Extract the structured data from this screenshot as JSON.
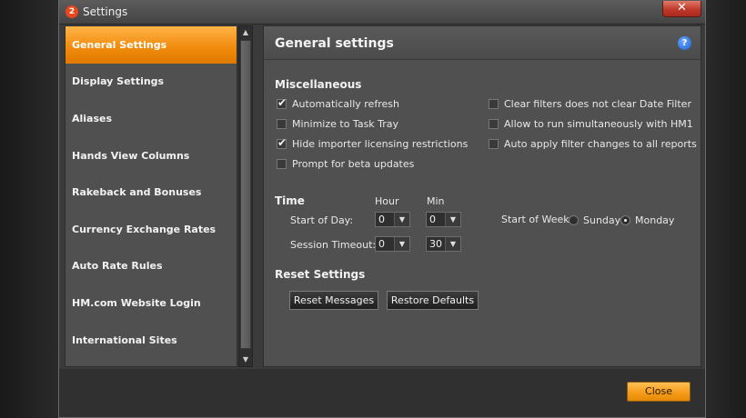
{
  "window": {
    "logo_text": "2",
    "title": "Settings",
    "close_glyph": "✕"
  },
  "sidebar": {
    "items": [
      {
        "label": "General Settings",
        "active": true
      },
      {
        "label": "Display Settings"
      },
      {
        "label": "Aliases"
      },
      {
        "label": "Hands View Columns"
      },
      {
        "label": "Rakeback and Bonuses"
      },
      {
        "label": "Currency Exchange Rates"
      },
      {
        "label": "Auto Rate Rules"
      },
      {
        "label": "HM.com Website Login"
      },
      {
        "label": "International Sites"
      }
    ]
  },
  "panel": {
    "title": "General settings",
    "help_glyph": "?"
  },
  "misc": {
    "title": "Miscellaneous",
    "left": [
      {
        "label": "Automatically refresh",
        "checked": true
      },
      {
        "label": "Minimize to Task Tray",
        "checked": false
      },
      {
        "label": "Hide importer licensing restrictions",
        "checked": true
      },
      {
        "label": "Prompt for beta updates",
        "checked": false
      }
    ],
    "right": [
      {
        "label": "Clear filters does not clear Date Filter",
        "checked": false
      },
      {
        "label": "Allow to run simultaneously with HM1",
        "checked": false
      },
      {
        "label": "Auto apply filter changes to all reports",
        "checked": false
      }
    ]
  },
  "time": {
    "title": "Time",
    "hour_header": "Hour",
    "min_header": "Min",
    "start_of_day_label": "Start of Day:",
    "start_of_day_hour": "0",
    "start_of_day_min": "0",
    "session_timeout_label": "Session Timeout:",
    "session_timeout_hour": "0",
    "session_timeout_min": "30",
    "start_of_week_label": "Start of Week:",
    "week_options": [
      {
        "label": "Sunday",
        "selected": false
      },
      {
        "label": "Monday",
        "selected": true
      }
    ]
  },
  "reset": {
    "title": "Reset Settings",
    "reset_messages_label": "Reset Messages",
    "restore_defaults_label": "Restore Defaults"
  },
  "footer": {
    "close_label": "Close"
  },
  "colors": {
    "accent_orange": "#f08a0b",
    "panel_bg": "#505050",
    "window_bg": "#3b3b3b",
    "close_x_red": "#c0392b",
    "help_blue": "#1c5fd4"
  }
}
